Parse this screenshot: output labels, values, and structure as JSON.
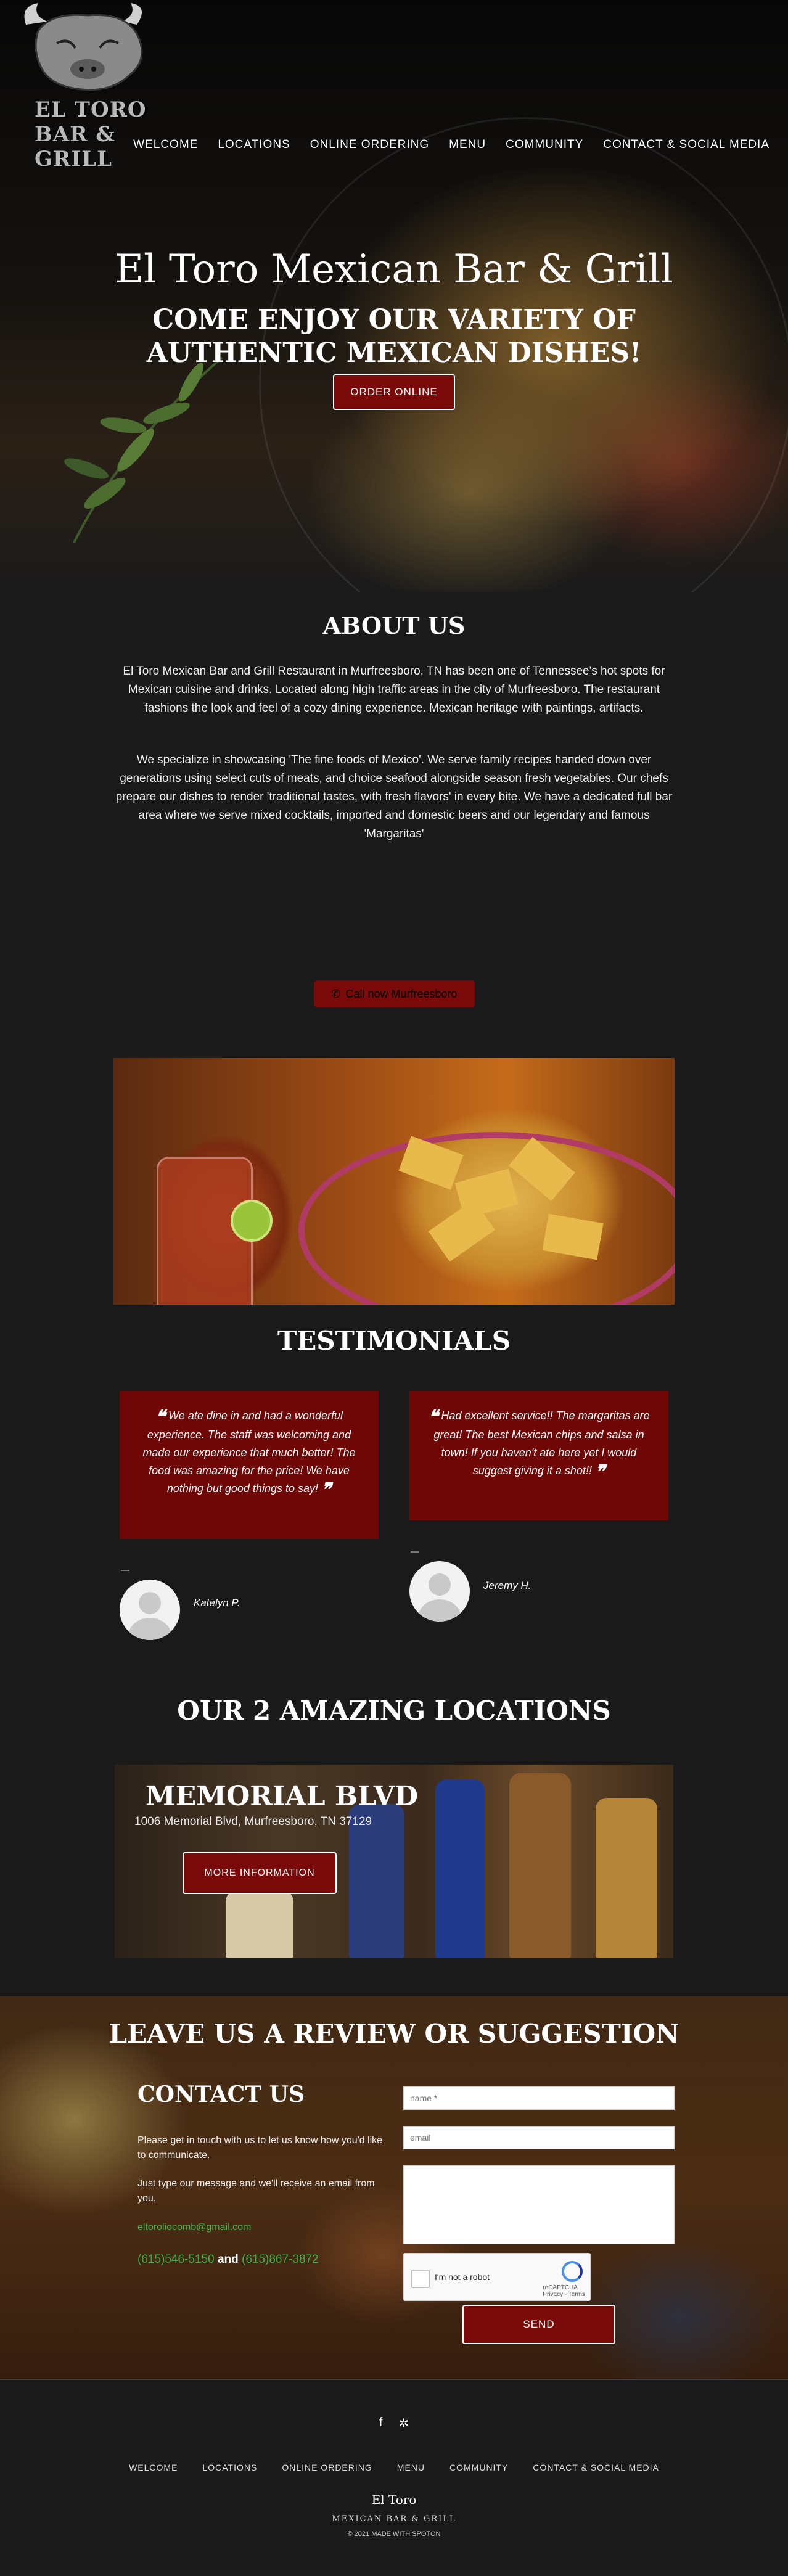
{
  "brand": {
    "logo_text": "EL TORO BAR & GRILL"
  },
  "nav": [
    "WELCOME",
    "LOCATIONS",
    "ONLINE ORDERING",
    "MENU",
    "COMMUNITY",
    "CONTACT & SOCIAL MEDIA"
  ],
  "hero": {
    "title": "El Toro Mexican Bar & Grill",
    "subtitle": "COME ENJOY OUR VARIETY OF AUTHENTIC MEXICAN DISHES!",
    "button": "ORDER ONLINE"
  },
  "about": {
    "title": "ABOUT US",
    "p1": "El Toro Mexican Bar and Grill Restaurant in Murfreesboro, TN has been one of Tennessee's hot spots for Mexican cuisine and drinks. Located along high traffic areas in the city of Murfreesboro. The restaurant fashions the look and feel of a cozy dining experience. Mexican heritage with paintings, artifacts.",
    "p2": "We specialize in showcasing 'The fine foods of Mexico'. We serve family recipes handed down over generations using select cuts of meats, and choice seafood alongside season fresh vegetables. Our chefs prepare our dishes to render 'traditional tastes, with fresh flavors' in every bite. We have a dedicated full bar area where we serve mixed cocktails, imported and domestic beers and our legendary and famous 'Margaritas'",
    "call_button": "Call now Murfreesboro"
  },
  "testimonials": {
    "title": "TESTIMONIALS",
    "items": [
      {
        "text": "We ate dine in and had a wonderful experience. The staff was welcoming and made our experience that much better! The food was amazing for the price! We have nothing but good things to say!",
        "name": "Katelyn P."
      },
      {
        "text": "Had excellent service!! The margaritas are great! The best Mexican chips and salsa in town! If you haven't ate here yet I would suggest giving it a shot!!",
        "name": "Jeremy H."
      }
    ]
  },
  "locations": {
    "title": "OUR 2 AMAZING LOCATIONS",
    "name": "MEMORIAL BLVD",
    "address": "1006 Memorial Blvd, Murfreesboro, TN 37129",
    "button": "MORE INFORMATION"
  },
  "contact": {
    "title": "LEAVE US A REVIEW OR SUGGESTION",
    "heading": "CONTACT US",
    "text1": "Please get in touch with us to let us know how you'd like to communicate.",
    "text2": "Just type our message and we'll receive an email from you.",
    "email": "eltoroliocomb@gmail.com",
    "phone1": "(615)546-5150",
    "and": "and",
    "phone2": "(615)867-3872",
    "name_placeholder": "name *",
    "email_placeholder": "email",
    "captcha_label": "I'm not a robot",
    "captcha_brand": "reCAPTCHA",
    "captcha_terms": "Privacy - Terms",
    "send": "SEND"
  },
  "footer": {
    "social": [
      "facebook-icon",
      "yelp-icon"
    ],
    "nav": [
      "WELCOME",
      "LOCATIONS",
      "ONLINE ORDERING",
      "MENU",
      "COMMUNITY",
      "CONTACT & SOCIAL MEDIA"
    ],
    "brand": "El Toro",
    "sub": "MEXICAN BAR & GRILL",
    "copyright": "© 2021 MADE WITH SPOTON"
  },
  "colors": {
    "accent": "#7a0a0a",
    "link_green": "#3fb04a",
    "background": "#1a1a1a"
  }
}
